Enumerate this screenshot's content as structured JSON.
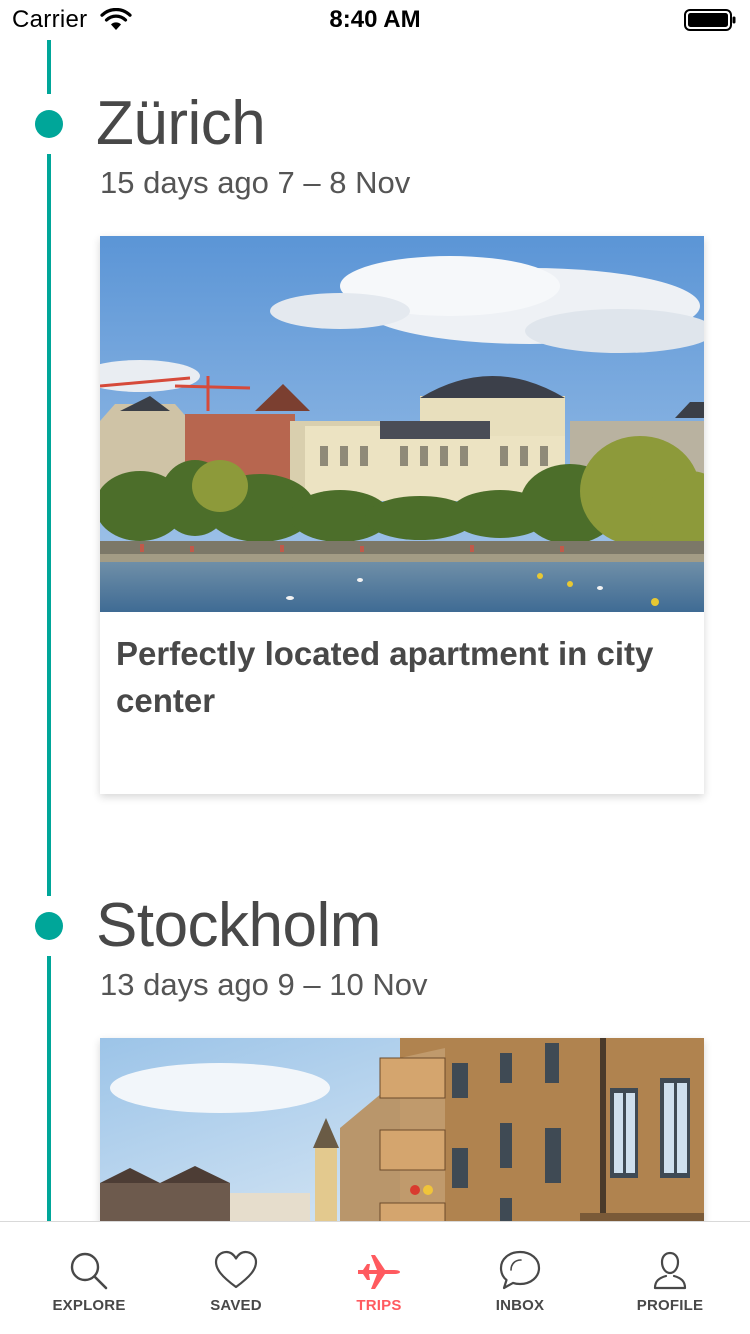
{
  "status_bar": {
    "carrier": "Carrier",
    "time": "8:40 AM"
  },
  "colors": {
    "timeline": "#00a699",
    "active_tab": "#ff5a5f",
    "text": "#484848"
  },
  "trips": [
    {
      "city": "Zürich",
      "dates": "15 days ago 7 – 8 Nov",
      "listing_title": "Perfectly located apartment in city center"
    },
    {
      "city": "Stockholm",
      "dates": "13 days ago 9 – 10 Nov"
    }
  ],
  "tab_bar": {
    "active": "trips",
    "tabs": [
      {
        "id": "explore",
        "label": "EXPLORE",
        "icon": "search-icon"
      },
      {
        "id": "saved",
        "label": "SAVED",
        "icon": "heart-icon"
      },
      {
        "id": "trips",
        "label": "TRIPS",
        "icon": "airplane-icon"
      },
      {
        "id": "inbox",
        "label": "INBOX",
        "icon": "chat-bubble-icon"
      },
      {
        "id": "profile",
        "label": "PROFILE",
        "icon": "person-icon"
      }
    ]
  }
}
